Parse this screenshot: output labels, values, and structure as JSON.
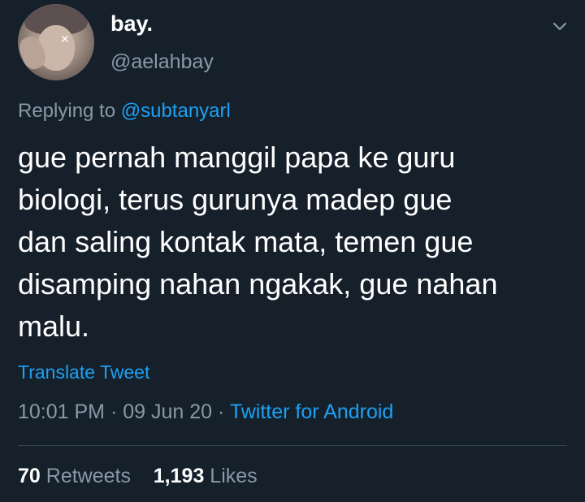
{
  "author": {
    "display_name": "bay.",
    "handle": "@aelahbay"
  },
  "reply": {
    "prefix": "Replying to",
    "to": "@subtanyarl"
  },
  "tweet": {
    "lines": [
      "gue pernah manggil papa ke guru",
      "biologi, terus gurunya madep gue",
      "dan saling kontak mata, temen gue",
      "disamping nahan ngakak, gue nahan",
      "malu."
    ]
  },
  "translate_label": "Translate Tweet",
  "meta": {
    "time": "10:01 PM",
    "separator": "·",
    "date": "09 Jun 20",
    "source": "Twitter for Android"
  },
  "stats": {
    "retweets_count": "70",
    "retweets_label": "Retweets",
    "likes_count": "1,193",
    "likes_label": "Likes"
  },
  "icons": {
    "menu": "chevron-down-icon"
  },
  "colors": {
    "background": "#15202b",
    "text_primary": "#ffffff",
    "text_secondary": "#8899a6",
    "accent": "#1da1f2",
    "divider": "#38444d"
  }
}
